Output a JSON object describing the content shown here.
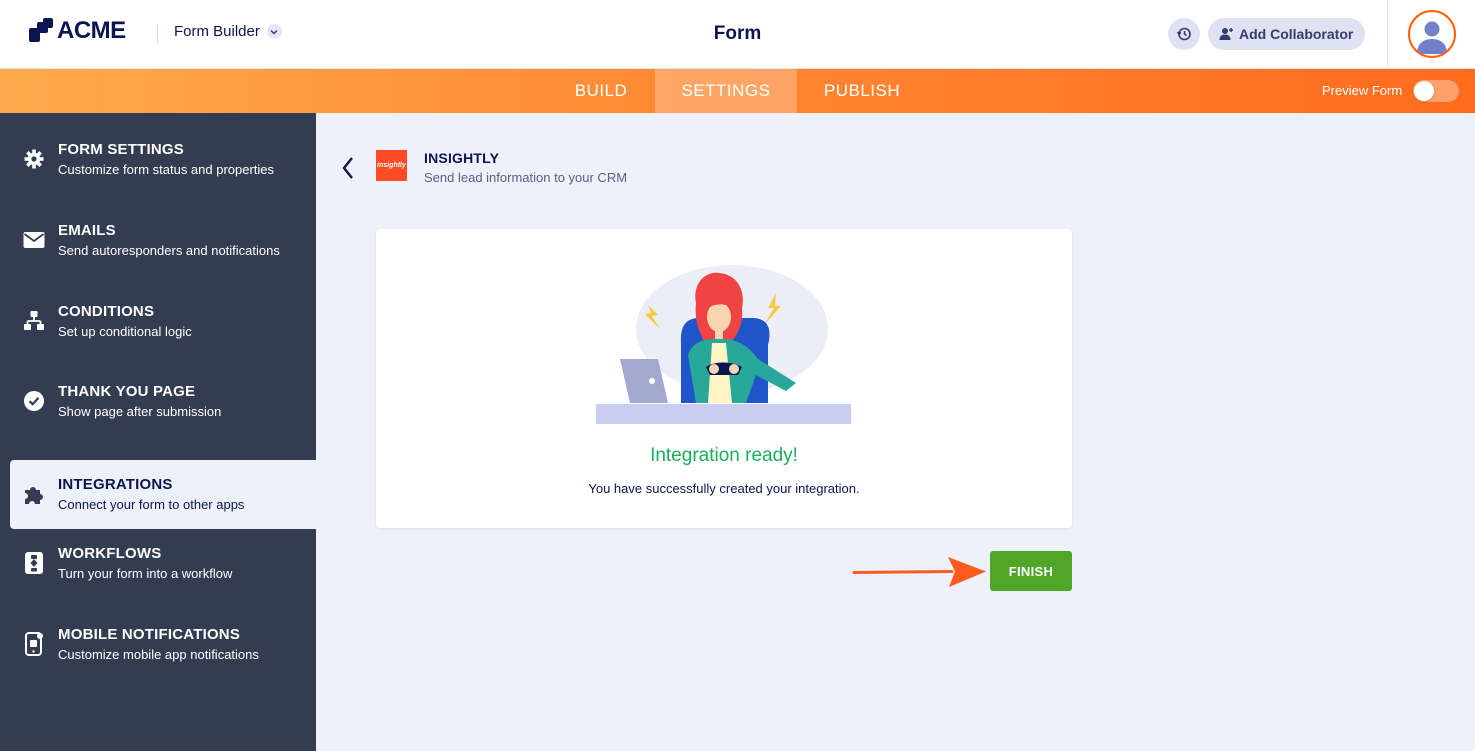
{
  "header": {
    "brand": "ACME",
    "app_switcher_label": "Form Builder",
    "page_title": "Form",
    "history_icon": "history-icon",
    "add_collaborator_label": "Add Collaborator"
  },
  "nav": {
    "tabs": [
      {
        "label": "BUILD",
        "active": false
      },
      {
        "label": "SETTINGS",
        "active": true
      },
      {
        "label": "PUBLISH",
        "active": false
      }
    ],
    "preview_label": "Preview Form",
    "preview_enabled": false
  },
  "sidebar": {
    "items": [
      {
        "title": "FORM SETTINGS",
        "subtitle": "Customize form status and properties",
        "icon": "gear-icon",
        "active": false
      },
      {
        "title": "EMAILS",
        "subtitle": "Send autoresponders and notifications",
        "icon": "envelope-icon",
        "active": false
      },
      {
        "title": "CONDITIONS",
        "subtitle": "Set up conditional logic",
        "icon": "conditions-icon",
        "active": false
      },
      {
        "title": "THANK YOU PAGE",
        "subtitle": "Show page after submission",
        "icon": "check-circle-icon",
        "active": false
      },
      {
        "title": "INTEGRATIONS",
        "subtitle": "Connect your form to other apps",
        "icon": "puzzle-icon",
        "active": true
      },
      {
        "title": "WORKFLOWS",
        "subtitle": "Turn your form into a workflow",
        "icon": "workflow-icon",
        "active": false
      },
      {
        "title": "MOBILE NOTIFICATIONS",
        "subtitle": "Customize mobile app notifications",
        "icon": "mobile-icon",
        "active": false
      }
    ]
  },
  "integration": {
    "name": "INSIGHTLY",
    "description": "Send lead information to your CRM",
    "logo_text": "insightly"
  },
  "card": {
    "heading": "Integration ready!",
    "message": "You have successfully created your integration."
  },
  "actions": {
    "finish_label": "FINISH"
  },
  "colors": {
    "accent_orange": "#ff6b1c",
    "sidebar_bg": "#343c52",
    "success_green": "#18b05a",
    "finish_button": "#4fa628"
  }
}
